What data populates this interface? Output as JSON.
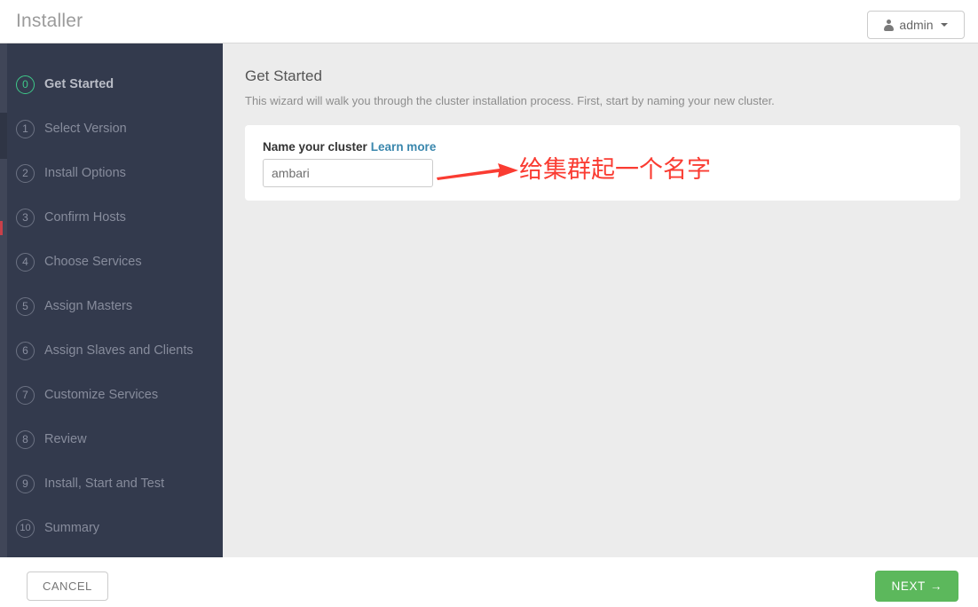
{
  "header": {
    "title": "Installer",
    "admin_label": "admin",
    "user_icon": "user-icon",
    "caret_icon": "chevron-down-icon"
  },
  "sidebar": {
    "steps": [
      {
        "number": "0",
        "label": "Get Started",
        "active": true
      },
      {
        "number": "1",
        "label": "Select Version",
        "active": false
      },
      {
        "number": "2",
        "label": "Install Options",
        "active": false
      },
      {
        "number": "3",
        "label": "Confirm Hosts",
        "active": false
      },
      {
        "number": "4",
        "label": "Choose Services",
        "active": false
      },
      {
        "number": "5",
        "label": "Assign Masters",
        "active": false
      },
      {
        "number": "6",
        "label": "Assign Slaves and Clients",
        "active": false
      },
      {
        "number": "7",
        "label": "Customize Services",
        "active": false
      },
      {
        "number": "8",
        "label": "Review",
        "active": false
      },
      {
        "number": "9",
        "label": "Install, Start and Test",
        "active": false
      },
      {
        "number": "10",
        "label": "Summary",
        "active": false
      }
    ]
  },
  "content": {
    "heading": "Get Started",
    "subtitle": "This wizard will walk you through the cluster installation process. First, start by naming your new cluster.",
    "card": {
      "label": "Name your cluster",
      "learn_more": "Learn more",
      "input_value": "ambari",
      "input_placeholder": "ambari"
    }
  },
  "annotation": {
    "text": "给集群起一个名字",
    "color": "#fa3c32",
    "arrow_icon": "arrow-right-icon"
  },
  "footer": {
    "cancel_label": "CANCEL",
    "next_label": "NEXT",
    "next_arrow": "→"
  },
  "colors": {
    "sidebar_bg": "#333a4d",
    "content_bg": "#ececec",
    "accent_green": "#5cb85c",
    "active_step_green": "#3ec98a",
    "link_blue": "#3a87ad"
  }
}
